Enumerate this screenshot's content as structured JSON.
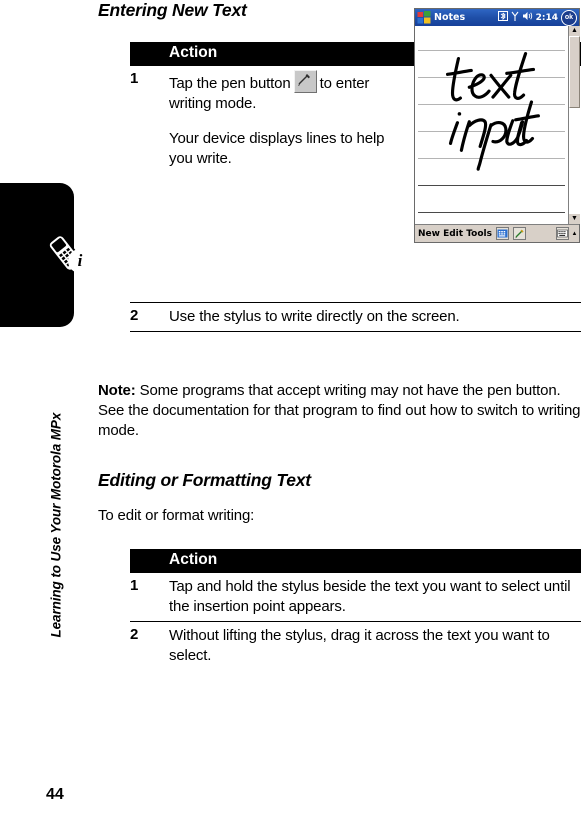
{
  "sidebar": {
    "tab_label": "Learning to Use Your Motorola MPx",
    "page_number": "44",
    "info_glyph": "i",
    "phone_icon_name": "mobile-phone-icon"
  },
  "main": {
    "section_one_title": "Entering New Text",
    "section_two_title": "Editing or Formatting Text",
    "note_paragraph": "Note: Some programs that accept writing may not have the pen button. See the documentation for that program to find out how to switch to writing mode.",
    "note_label": "Note:",
    "note_rest": " Some programs that accept writing may not have the pen button. See the documentation for that program to find out how to switch to writing mode.",
    "intro_paragraph": "To edit or format writing:"
  },
  "table_one": {
    "header": "Action",
    "rows": [
      {
        "number": "1",
        "text_before_icon": "Tap the pen button",
        "icon_name": "pen-button-icon",
        "text_after_icon": "to enter writing mode.",
        "sub_text": "Your device displays lines to help you write."
      },
      {
        "number": "2",
        "text": "Use the stylus to write directly on the screen."
      }
    ]
  },
  "table_two": {
    "header": "Action",
    "rows": [
      {
        "number": "1",
        "text": "Tap and hold the stylus beside the text you want to select until the insertion point appears."
      },
      {
        "number": "2",
        "text": "Without lifting the stylus, drag it across the text you want to select."
      }
    ]
  },
  "pda": {
    "title": "Notes",
    "start_icon_name": "windows-start-icon",
    "tray": {
      "icons": [
        "bluetooth-icon",
        "signal-icon",
        "volume-icon"
      ],
      "clock": "2:14",
      "ok_label": "ok"
    },
    "ink": {
      "line_one": "text",
      "line_two": "input"
    },
    "toolbar": {
      "menus": [
        "New",
        "Edit",
        "Tools"
      ],
      "menu_text": "New Edit Tools",
      "icons": [
        "keyboard-small-icon",
        "pen-tool-icon"
      ],
      "sip_icon_name": "soft-input-panel-icon",
      "sip_arrow": "▲"
    },
    "scrollbar": {
      "up_arrow": "▲",
      "down_arrow": "▼"
    }
  },
  "colors": {
    "titlebar_blue": "#1f4fa8",
    "chrome_gray": "#d8d0c8",
    "header_black": "#000000",
    "rule_gray": "#b4b4b4"
  }
}
